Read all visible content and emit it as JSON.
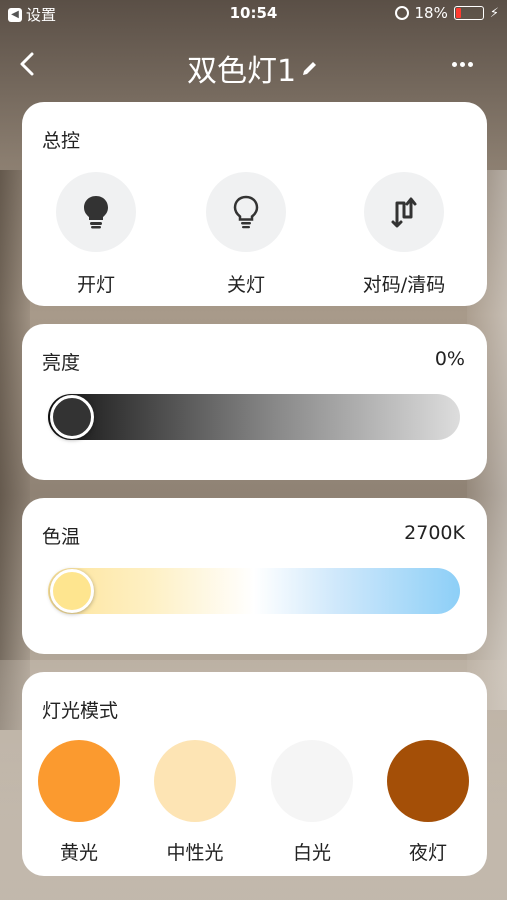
{
  "status_bar": {
    "back_app_label": "设置",
    "time": "10:54",
    "battery_percent": "18%",
    "battery_level": 0.18,
    "battery_color": "#ff3b30"
  },
  "nav": {
    "title": "双色灯1",
    "back_icon": "chevron-left-icon",
    "edit_icon": "pencil-icon",
    "more_icon": "more-dots-icon"
  },
  "master_control": {
    "title": "总控",
    "buttons": [
      {
        "label": "开灯",
        "icon": "bulb-filled-icon"
      },
      {
        "label": "关灯",
        "icon": "bulb-outline-icon"
      },
      {
        "label": "对码/清码",
        "icon": "pairing-icon"
      }
    ]
  },
  "brightness": {
    "title": "亮度",
    "value_text": "0%",
    "value": 0
  },
  "color_temp": {
    "title": "色温",
    "value_text": "2700K",
    "value": 0
  },
  "light_mode": {
    "title": "灯光模式",
    "modes": [
      {
        "label": "黄光",
        "color": "#fb9a2f"
      },
      {
        "label": "中性光",
        "color": "#fde4b4"
      },
      {
        "label": "白光",
        "color": "#f5f5f5"
      },
      {
        "label": "夜灯",
        "color": "#a44f07"
      }
    ]
  }
}
